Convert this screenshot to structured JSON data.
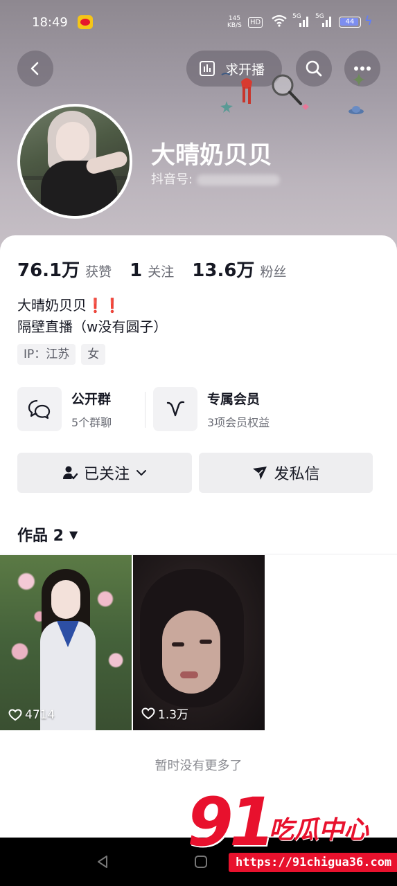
{
  "status_bar": {
    "time": "18:49",
    "net_speed_value": "145",
    "net_speed_unit": "KB/S",
    "hd_label": "HD",
    "signal1_label": "5G",
    "signal2_label": "5G",
    "battery": "44"
  },
  "header": {
    "request_live_label": "求开播"
  },
  "profile": {
    "name": "大晴奶贝贝",
    "douyin_id_label": "抖音号:"
  },
  "stats": [
    {
      "value": "76.1万",
      "label": "获赞"
    },
    {
      "value": "1",
      "label": "关注"
    },
    {
      "value": "13.6万",
      "label": "粉丝"
    }
  ],
  "bio": {
    "line1": "大晴奶贝贝",
    "line1_marks": "❗❗",
    "line2": "隔壁直播（w没有圆子）"
  },
  "tags": [
    "IP：江苏",
    "女"
  ],
  "features": [
    {
      "title": "公开群",
      "subtitle": "5个群聊",
      "icon": "chat-bubbles-icon"
    },
    {
      "title": "专属会员",
      "subtitle": "3项会员权益",
      "icon": "member-v-icon"
    }
  ],
  "actions": {
    "follow_label": "已关注",
    "message_label": "发私信"
  },
  "works": {
    "tab_label": "作品 2",
    "items": [
      {
        "likes": "4714"
      },
      {
        "likes": "1.3万"
      }
    ],
    "no_more_label": "暂时没有更多了"
  },
  "watermark": {
    "number": "91",
    "text": "吃瓜中心",
    "url": "https://91chigua36.com"
  },
  "colors": {
    "accent_red": "#e8112d",
    "text_primary": "#161823",
    "text_secondary": "#6b6d76",
    "button_bg": "#eeeef0"
  }
}
